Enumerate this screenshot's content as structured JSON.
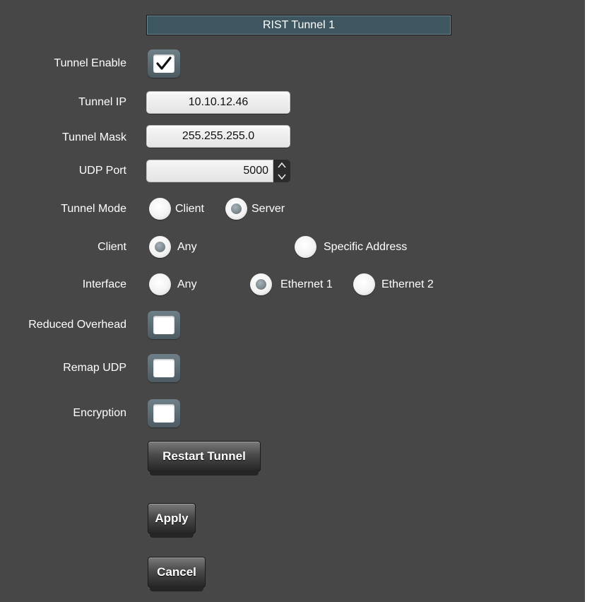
{
  "header": {
    "title": "RIST Tunnel 1"
  },
  "labels": {
    "tunnel_enable": "Tunnel Enable",
    "tunnel_ip": "Tunnel IP",
    "tunnel_mask": "Tunnel Mask",
    "udp_port": "UDP Port",
    "tunnel_mode": "Tunnel Mode",
    "client": "Client",
    "interface": "Interface",
    "reduced_overhead": "Reduced Overhead",
    "remap_udp": "Remap UDP",
    "encryption": "Encryption"
  },
  "fields": {
    "tunnel_ip": "10.10.12.46",
    "tunnel_mask": "255.255.255.0",
    "udp_port": "5000"
  },
  "checkboxes": {
    "tunnel_enable": true,
    "reduced_overhead": false,
    "remap_udp": false,
    "encryption": false
  },
  "tunnel_mode": {
    "options": [
      "Client",
      "Server"
    ],
    "selected": "Server"
  },
  "client": {
    "options": [
      "Any",
      "Specific Address"
    ],
    "selected": "Any"
  },
  "interface": {
    "options": [
      "Any",
      "Ethernet 1",
      "Ethernet 2"
    ],
    "selected": "Ethernet 1"
  },
  "buttons": {
    "restart": "Restart Tunnel",
    "apply": "Apply",
    "cancel": "Cancel"
  },
  "icons": {
    "check": "checkmark-icon",
    "spin_up": "chevron-up-icon",
    "spin_down": "chevron-down-icon"
  },
  "colors": {
    "panel_bg": "#474747",
    "title_bg": "#3e5660",
    "text": "#ffffff"
  }
}
